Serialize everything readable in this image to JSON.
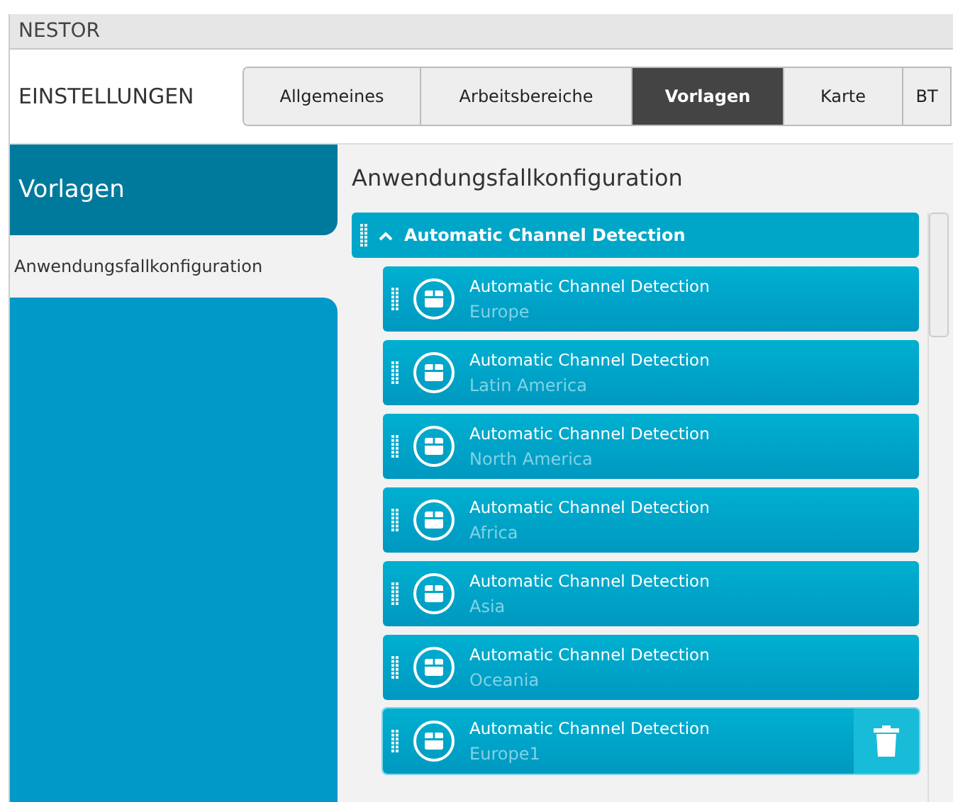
{
  "app_title": "NESTOR",
  "header": {
    "title": "EINSTELLUNGEN"
  },
  "tabs": [
    {
      "label": "Allgemeines",
      "selected": false
    },
    {
      "label": "Arbeitsbereiche",
      "selected": false
    },
    {
      "label": "Vorlagen",
      "selected": true
    },
    {
      "label": "Karte",
      "selected": false
    },
    {
      "label": "BT",
      "selected": false
    }
  ],
  "sidebar": {
    "title": "Vorlagen",
    "items": [
      {
        "label": "Anwendungsfallkonfiguration",
        "selected": false
      }
    ]
  },
  "content": {
    "title": "Anwendungsfallkonfiguration",
    "group": {
      "label": "Automatic Channel Detection",
      "expanded": true,
      "items": [
        {
          "title": "Automatic Channel Detection",
          "subtitle": "Europe",
          "selected": false
        },
        {
          "title": "Automatic Channel Detection",
          "subtitle": "Latin America",
          "selected": false
        },
        {
          "title": "Automatic Channel Detection",
          "subtitle": "North America",
          "selected": false
        },
        {
          "title": "Automatic Channel Detection",
          "subtitle": "Africa",
          "selected": false
        },
        {
          "title": "Automatic Channel Detection",
          "subtitle": "Asia",
          "selected": false
        },
        {
          "title": "Automatic Channel Detection",
          "subtitle": "Oceania",
          "selected": false
        },
        {
          "title": "Automatic Channel Detection",
          "subtitle": "Europe1",
          "selected": true
        }
      ]
    }
  }
}
